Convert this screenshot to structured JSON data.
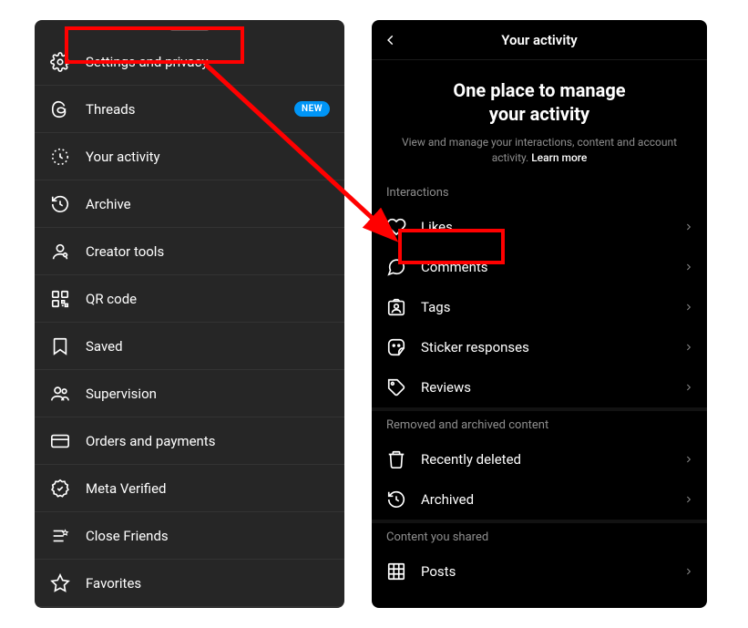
{
  "left_menu": {
    "settings": "Settings and privacy",
    "threads": "Threads",
    "threads_badge": "NEW",
    "your_activity": "Your activity",
    "archive": "Archive",
    "creator_tools": "Creator tools",
    "qr_code": "QR code",
    "saved": "Saved",
    "supervision": "Supervision",
    "orders": "Orders and payments",
    "meta_verified": "Meta Verified",
    "close_friends": "Close Friends",
    "favorites": "Favorites"
  },
  "right_screen": {
    "header_title": "Your activity",
    "hero_title_l1": "One place to manage",
    "hero_title_l2": "your activity",
    "hero_sub": "View and manage your interactions, content and account activity.",
    "learn_more": "Learn more",
    "sections": {
      "interactions": {
        "title": "Interactions",
        "likes": "Likes",
        "comments": "Comments",
        "tags": "Tags",
        "sticker": "Sticker responses",
        "reviews": "Reviews"
      },
      "removed": {
        "title": "Removed and archived content",
        "recently_deleted": "Recently deleted",
        "archived": "Archived"
      },
      "shared": {
        "title": "Content you shared",
        "posts": "Posts"
      }
    }
  }
}
